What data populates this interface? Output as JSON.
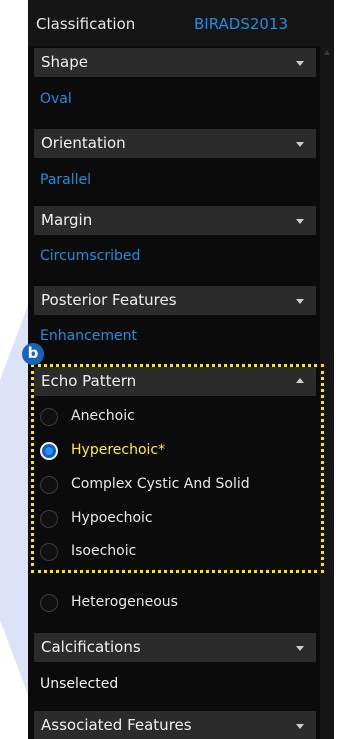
{
  "classification": {
    "label": "Classification",
    "value": "BIRADS2013"
  },
  "sections": [
    {
      "title": "Shape",
      "value": "Oval",
      "value_color": "#1e8fe0"
    },
    {
      "title": "Orientation",
      "value": "Parallel",
      "value_color": "#1e8fe0"
    },
    {
      "title": "Margin",
      "value": "Circumscribed",
      "value_color": "#1e8fe0"
    },
    {
      "title": "Posterior Features",
      "value": "Enhancement",
      "value_color": "#1e8fe0"
    },
    {
      "title": "Echo Pattern",
      "expanded": true
    },
    {
      "title": "Calcifications",
      "value": "Unselected",
      "value_color": "#f0f0f0"
    },
    {
      "title": "Associated Features"
    }
  ],
  "echo_pattern_options": [
    {
      "label": "Anechoic",
      "checked": false
    },
    {
      "label": "Hyperechoic*",
      "checked": true
    },
    {
      "label": "Complex Cystic And Solid",
      "checked": false
    },
    {
      "label": "Hypoechoic",
      "checked": false
    },
    {
      "label": "Isoechoic",
      "checked": false
    },
    {
      "label": "Heterogeneous",
      "checked": false
    }
  ],
  "annotation": {
    "badge": "b",
    "highlight_color": "#ffe600"
  },
  "colors": {
    "accent": "#1e8fe0",
    "selected_text": "#ffeb3b",
    "panel_bg": "#0b0b0b",
    "header_bg": "#2b2b2b"
  },
  "icons": {
    "collapse": "chevron-down-icon",
    "expand": "chevron-up-icon"
  }
}
